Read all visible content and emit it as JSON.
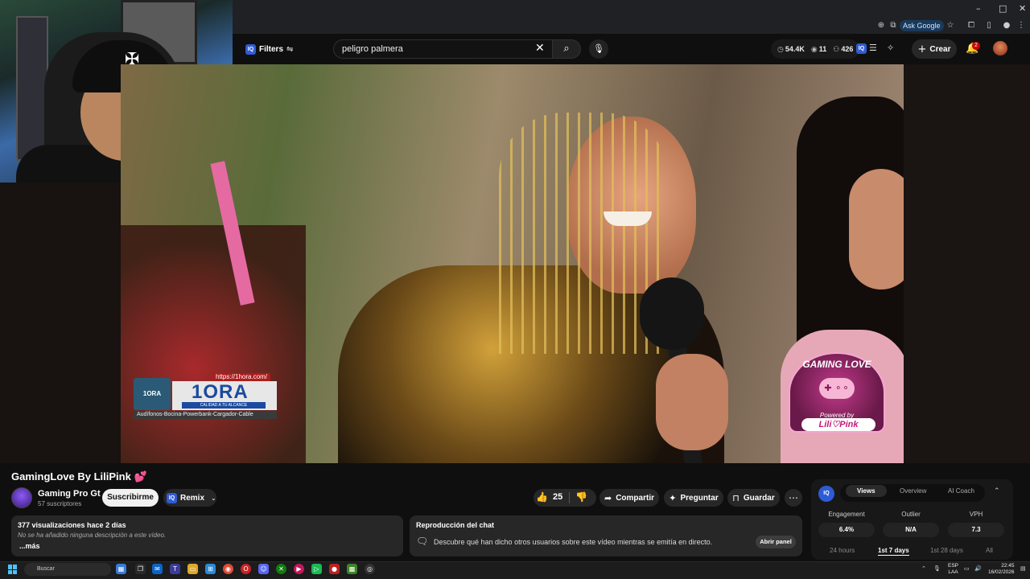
{
  "browser": {
    "ask_google": "Ask Google"
  },
  "header": {
    "filters_label": "Filters",
    "iq_badge": "IQ",
    "search_value": "peligro palmera",
    "stats": {
      "views": "54.4K",
      "watching": "11",
      "likes": "426"
    },
    "create_label": "Crear",
    "notifications_count": "2"
  },
  "ad": {
    "url": "https://1hora.com/",
    "logo_small": "1ORA",
    "brand": "1ORA",
    "tagline": "CALIDAD A TU ALCANCE",
    "products": "Audífonos-Bocina-Powerbank-Cargador-Cable"
  },
  "badge": {
    "title": "GAMING LOVE",
    "powered": "Powered by",
    "brand": "Lili♡Pink"
  },
  "video": {
    "title": "GamingLove By LiliPink",
    "channel_name": "Gaming Pro Gt",
    "subscribers": "57 suscriptores",
    "subscribe_label": "Suscribirme",
    "remix_label": "Remix",
    "like_count": "25",
    "share_label": "Compartir",
    "ask_label": "Preguntar",
    "save_label": "Guardar"
  },
  "description": {
    "views_and_date": "377 visualizaciones  hace 2 días",
    "empty_text": "No se ha añadido ninguna descripción a este vídeo.",
    "more_label": "...más"
  },
  "chat_replay": {
    "title": "Reproducción del chat",
    "description": "Descubre qué han dicho otros usuarios sobre este vídeo mientras se emitía en directo.",
    "open_panel_label": "Abrir panel"
  },
  "iq_panel": {
    "logo": "IQ",
    "tabs": [
      "Views",
      "Overview",
      "AI Coach"
    ],
    "metrics": [
      {
        "label": "Engagement",
        "value": "6.4%"
      },
      {
        "label": "Outlier",
        "value": "N/A"
      },
      {
        "label": "VPH",
        "value": "7.3"
      }
    ],
    "ranges": [
      "24 hours",
      "1st 7 days",
      "1st 28 days",
      "All"
    ]
  },
  "taskbar": {
    "search_placeholder": "Buscar",
    "lang_line1": "ESP",
    "lang_line2": "LAA",
    "time": "22:45",
    "date": "16/02/2026"
  },
  "colors": {
    "accent": "#2e5bd6",
    "notification": "#cc0000",
    "heart": "#e83e8c"
  }
}
